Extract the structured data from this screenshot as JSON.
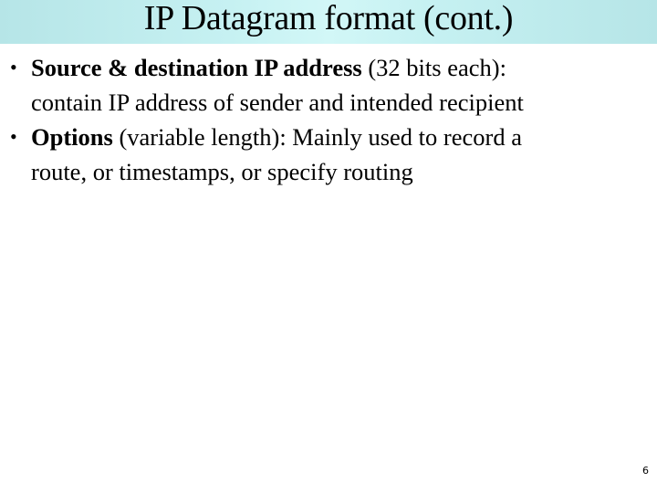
{
  "slide": {
    "title": "IP Datagram format (cont.)",
    "page_number": "6",
    "title_bar_color": "#b8e6e8",
    "bullet_glyph": "•",
    "bullets": [
      {
        "term": "Source & destination IP address",
        "rest_line1": " (32 bits each):",
        "rest_line2": "contain IP address of sender and intended recipient"
      },
      {
        "term": "Options",
        "rest_line1": " (variable length): Mainly used to record a",
        "rest_line2": "route, or timestamps, or specify routing"
      }
    ]
  }
}
